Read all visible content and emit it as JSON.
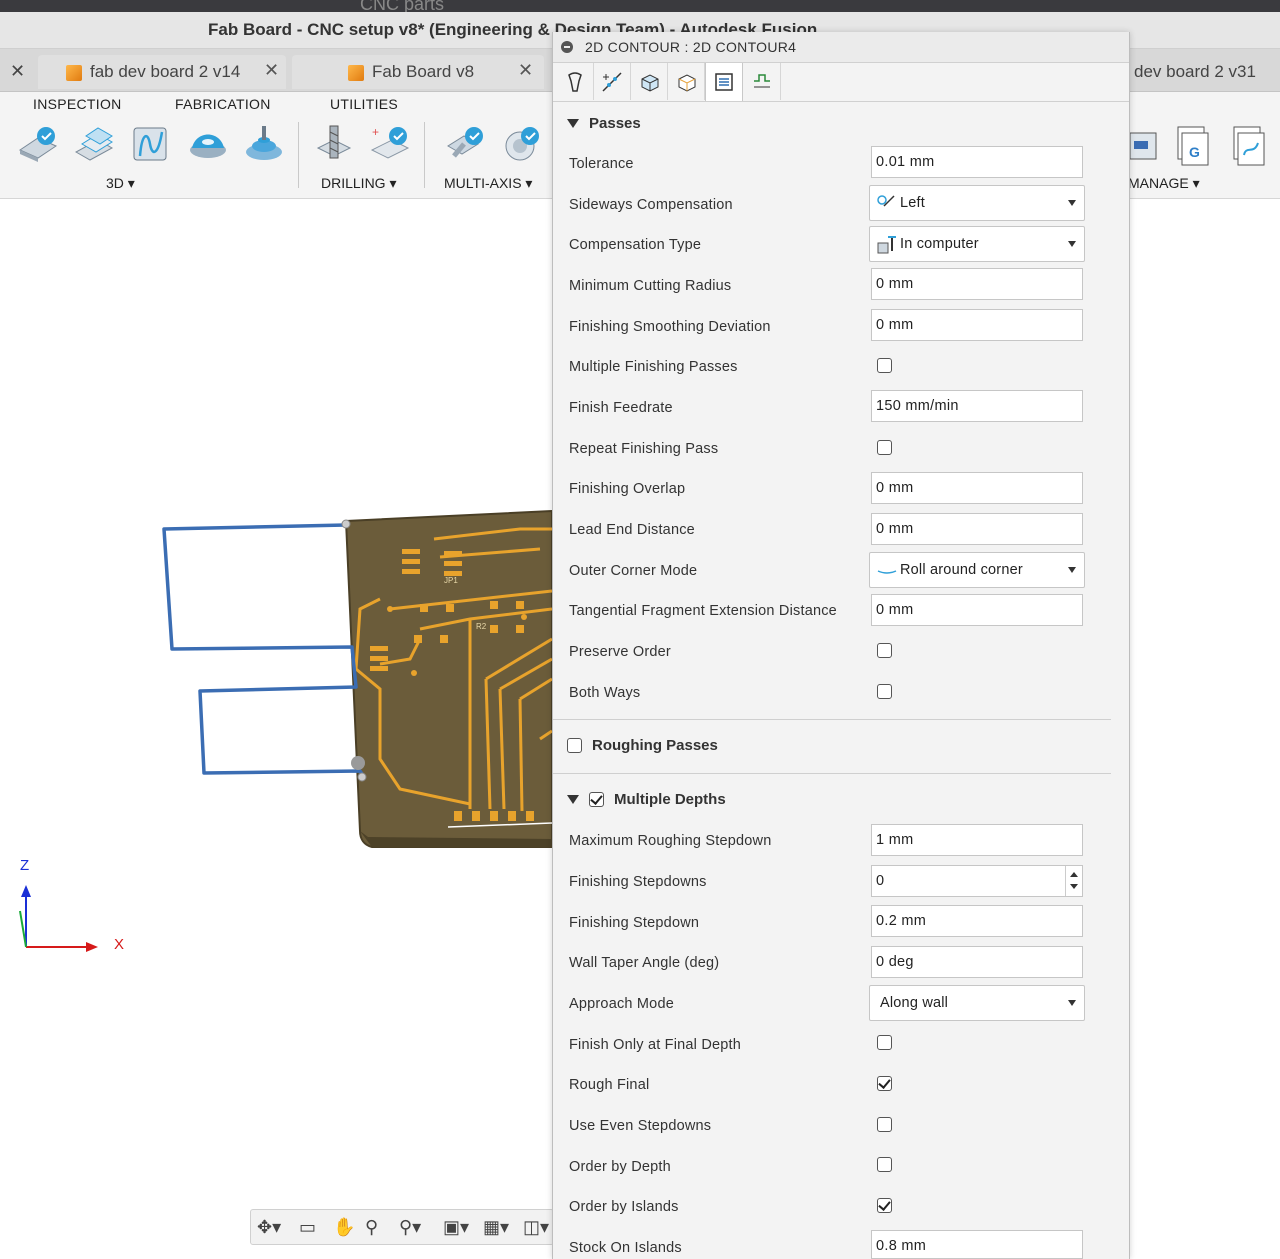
{
  "window": {
    "ghost_title": "CNC parts",
    "title": "Fab Board - CNC setup v8* (Engineering & Design Team) - Autodesk Fusion"
  },
  "tabs": [
    {
      "label": "fab dev board 2 v14"
    },
    {
      "label": "Fab Board v8"
    },
    {
      "label": "dev board 2 v31"
    }
  ],
  "toolbar": {
    "menus": [
      "INSPECTION",
      "FABRICATION",
      "UTILITIES"
    ],
    "groups": {
      "g3d": "3D",
      "drilling": "DRILLING",
      "multiaxis": "MULTI-AXIS",
      "manage": "MANAGE"
    }
  },
  "viewport": {
    "axis_z": "Z",
    "axis_x": "X",
    "pcb_labels": {
      "jp1": "JP1",
      "r2": "R2"
    }
  },
  "panel": {
    "title": "2D CONTOUR : 2D CONTOUR4",
    "passes": {
      "header": "Passes",
      "tolerance": {
        "label": "Tolerance",
        "value": "0.01 mm"
      },
      "sideways": {
        "label": "Sideways Compensation",
        "value": "Left"
      },
      "comp_type": {
        "label": "Compensation Type",
        "value": "In computer"
      },
      "min_radius": {
        "label": "Minimum Cutting Radius",
        "value": "0 mm"
      },
      "smoothing": {
        "label": "Finishing Smoothing Deviation",
        "value": "0 mm"
      },
      "multi_finish": {
        "label": "Multiple Finishing Passes",
        "checked": false
      },
      "finish_feed": {
        "label": "Finish Feedrate",
        "value": "150 mm/min"
      },
      "repeat_finish": {
        "label": "Repeat Finishing Pass",
        "checked": false
      },
      "overlap": {
        "label": "Finishing Overlap",
        "value": "0 mm"
      },
      "lead_end": {
        "label": "Lead End Distance",
        "value": "0 mm"
      },
      "outer_corner": {
        "label": "Outer Corner Mode",
        "value": "Roll around corner"
      },
      "tangential": {
        "label": "Tangential Fragment Extension Distance",
        "value": "0 mm"
      },
      "preserve_order": {
        "label": "Preserve Order",
        "checked": false
      },
      "both_ways": {
        "label": "Both Ways",
        "checked": false
      }
    },
    "roughing": {
      "header": "Roughing Passes",
      "checked": false
    },
    "depths": {
      "header": "Multiple Depths",
      "checked": true,
      "max_stepdown": {
        "label": "Maximum Roughing Stepdown",
        "value": "1 mm"
      },
      "finish_stepdowns": {
        "label": "Finishing Stepdowns",
        "value": "0"
      },
      "finish_stepdown": {
        "label": "Finishing Stepdown",
        "value": "0.2 mm"
      },
      "wall_taper": {
        "label": "Wall Taper Angle (deg)",
        "value": "0 deg"
      },
      "approach": {
        "label": "Approach Mode",
        "value": "Along wall"
      },
      "finish_final": {
        "label": "Finish Only at Final Depth",
        "checked": false
      },
      "rough_final": {
        "label": "Rough Final",
        "checked": true
      },
      "even_steps": {
        "label": "Use Even Stepdowns",
        "checked": false
      },
      "order_depth": {
        "label": "Order by Depth",
        "checked": false
      },
      "order_islands": {
        "label": "Order by Islands",
        "checked": true
      },
      "stock_islands": {
        "label": "Stock On Islands",
        "value": "0.8 mm"
      }
    }
  },
  "colors": {
    "accent": "#2f9fd8",
    "toolpath": "#3b6db3",
    "pcb": "#6b5c3a",
    "traces": "#e8a32c"
  }
}
